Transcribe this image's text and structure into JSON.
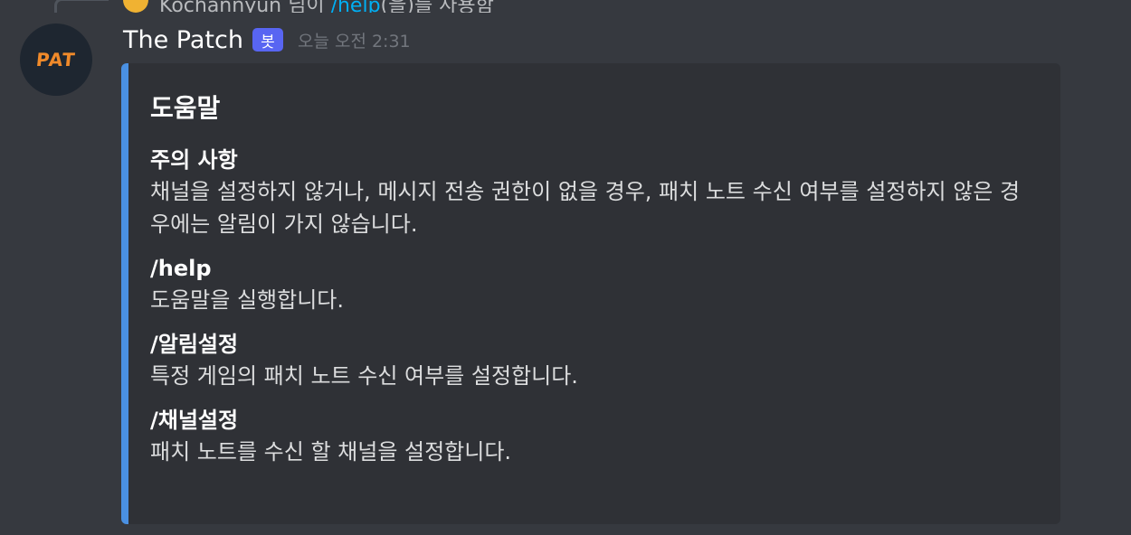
{
  "reply": {
    "user": "Kochannyun",
    "suffix": " 님이 ",
    "command": "/help",
    "after": "(을)를 사용함"
  },
  "message": {
    "author": "The Patch",
    "bot_tag": "봇",
    "timestamp": "오늘 오전 2:31",
    "avatar_text": "PAT"
  },
  "embed": {
    "accent_color": "#4a90e2",
    "title": "도움말",
    "fields": [
      {
        "name": "주의 사항",
        "value": "채널을 설정하지 않거나, 메시지 전송 권한이 없을 경우, 패치 노트 수신 여부를 설정하지 않은 경우에는 알림이 가지 않습니다."
      },
      {
        "name": "/help",
        "value": "도움말을 실행합니다."
      },
      {
        "name": "/알림설정",
        "value": "특정 게임의 패치 노트 수신 여부를 설정합니다."
      },
      {
        "name": "/채널설정",
        "value": "패치 노트를 수신 할 채널을 설정합니다."
      }
    ]
  }
}
